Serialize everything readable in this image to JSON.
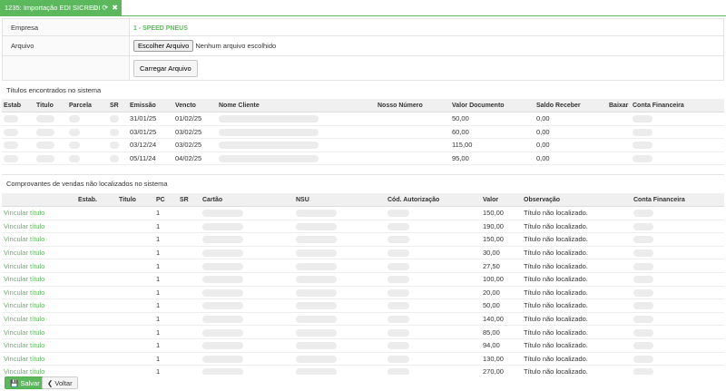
{
  "tab": {
    "title": "1235: Importação EDI SICREDI",
    "icons": "☆ ⟳ ✖"
  },
  "form": {
    "empresa_label": "Empresa",
    "empresa_value": "1 - SPEED PNEUS",
    "arquivo_label": "Arquivo",
    "file_button": "Escolher Arquivo",
    "file_status": "Nenhum arquivo escolhido",
    "load_button": "Carregar Arquivo"
  },
  "found": {
    "title": "Títulos encontrados no sistema",
    "headers": [
      "Estab",
      "Titulo",
      "Parcela",
      "SR",
      "Emissão",
      "Vencto",
      "Nome Cliente",
      "Nosso Número",
      "Valor Documento",
      "Saldo Receber",
      "Baixar",
      "Conta Financeira"
    ],
    "rows": [
      {
        "emissao": "31/01/25",
        "vencto": "01/02/25",
        "valor": "50,00",
        "saldo": "0,00"
      },
      {
        "emissao": "03/01/25",
        "vencto": "03/02/25",
        "valor": "60,00",
        "saldo": "0,00"
      },
      {
        "emissao": "03/12/24",
        "vencto": "03/02/25",
        "valor": "115,00",
        "saldo": "0,00"
      },
      {
        "emissao": "05/11/24",
        "vencto": "04/02/25",
        "valor": "95,00",
        "saldo": "0,00"
      }
    ]
  },
  "notfound": {
    "title": "Comprovantes de vendas não localizados no sistema",
    "headers": [
      "",
      "Estab.",
      "Titulo",
      "PC",
      "SR",
      "Cartão",
      "NSU",
      "Cód. Autorização",
      "Valor",
      "Observação",
      "Conta Financeira"
    ],
    "link_label": "Vincular título",
    "rows": [
      {
        "pc": "1",
        "valor": "150,00",
        "obs": "Título não localizado."
      },
      {
        "pc": "1",
        "valor": "190,00",
        "obs": "Título não localizado."
      },
      {
        "pc": "1",
        "valor": "150,00",
        "obs": "Título não localizado."
      },
      {
        "pc": "1",
        "valor": "30,00",
        "obs": "Título não localizado."
      },
      {
        "pc": "1",
        "valor": "27,50",
        "obs": "Título não localizado."
      },
      {
        "pc": "1",
        "valor": "100,00",
        "obs": "Título não localizado."
      },
      {
        "pc": "1",
        "valor": "20,00",
        "obs": "Título não localizado."
      },
      {
        "pc": "1",
        "valor": "50,00",
        "obs": "Título não localizado."
      },
      {
        "pc": "1",
        "valor": "140,00",
        "obs": "Título não localizado."
      },
      {
        "pc": "1",
        "valor": "85,00",
        "obs": "Título não localizado."
      },
      {
        "pc": "1",
        "valor": "94,00",
        "obs": "Título não localizado."
      },
      {
        "pc": "1",
        "valor": "130,00",
        "obs": "Título não localizado."
      },
      {
        "pc": "1",
        "valor": "270,00",
        "obs": "Título não localizado."
      }
    ]
  },
  "footer": {
    "save": "Salvar",
    "back": "Voltar",
    "save_icon": "floppy-icon",
    "back_icon": "chevron-left-icon"
  },
  "colors": {
    "accent": "#5cb85c"
  }
}
